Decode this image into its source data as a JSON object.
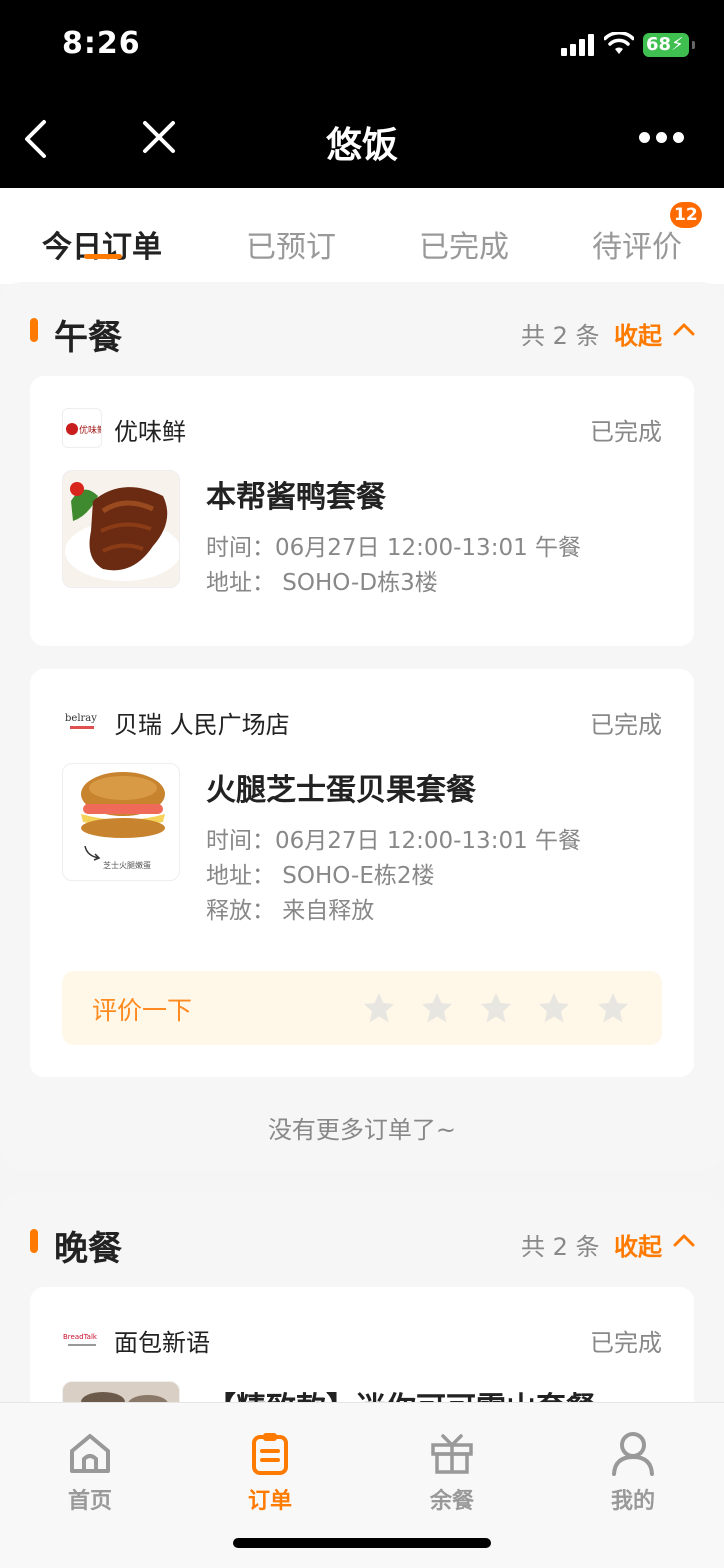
{
  "status_bar": {
    "time": "8:26",
    "battery": "68"
  },
  "nav": {
    "title": "悠饭"
  },
  "tabs": [
    {
      "label": "今日订单",
      "active": true
    },
    {
      "label": "已预订",
      "active": false
    },
    {
      "label": "已完成",
      "active": false
    },
    {
      "label": "待评价",
      "active": false,
      "badge": "12"
    }
  ],
  "lunch": {
    "title": "午餐",
    "count": "共 2 条",
    "collapse_label": "收起",
    "orders": [
      {
        "shop": "优味鲜",
        "logo_text": "优味鲜",
        "status": "已完成",
        "dish": "本帮酱鸭套餐",
        "time_line": "时间：06月27日 12:00-13:01 午餐",
        "address_line": "地址：  SOHO-D栋3楼"
      },
      {
        "shop": "贝瑞 人民广场店",
        "logo_text": "belray",
        "status": "已完成",
        "dish": "火腿芝士蛋贝果套餐",
        "thumb_caption": "芝士火腿嫩蛋",
        "time_line": "时间：06月27日 12:00-13:01 午餐",
        "address_line": "地址：  SOHO-E栋2楼",
        "release_line": "释放：  来自释放",
        "rate_label": "评价一下",
        "rating": 0,
        "rating_max": 5
      }
    ],
    "no_more": "没有更多订单了~"
  },
  "dinner": {
    "title": "晚餐",
    "count": "共 2 条",
    "collapse_label": "收起",
    "orders": [
      {
        "shop": "面包新语",
        "logo_text": "BreadTalk",
        "status": "已完成",
        "dish": "【精致款】迷你可可雪山套餐"
      }
    ]
  },
  "bottom_nav": [
    {
      "label": "首页",
      "icon": "home-icon",
      "active": false
    },
    {
      "label": "订单",
      "icon": "order-icon",
      "active": true
    },
    {
      "label": "余餐",
      "icon": "gift-icon",
      "active": false
    },
    {
      "label": "我的",
      "icon": "profile-icon",
      "active": false
    }
  ],
  "colors": {
    "accent": "#ff7a00",
    "rate_bg": "#fff7e8",
    "badge": "#ff6a00"
  }
}
